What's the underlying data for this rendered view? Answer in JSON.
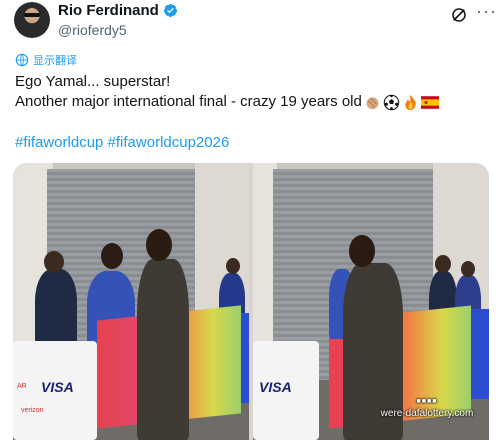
{
  "author": {
    "name": "Rio Ferdinand",
    "handle": "@rioferdy5",
    "verified": true,
    "avatar_icon": "avatar",
    "header_icons": [
      "grok-icon",
      "more-icon"
    ]
  },
  "translate_label": "显示翻译",
  "tweet": {
    "line1": "Ego Yamal... superstar!",
    "line2": "Another major international final - crazy 19 years old",
    "emojis": [
      "clapping-hands-icon",
      "soccer-ball-icon",
      "fire-icon",
      "spain-flag-icon"
    ],
    "hashtags": "#fifaworldcup #fifaworldcup2026"
  },
  "media": {
    "photo_count": 2,
    "banner_left_text": "VISA",
    "banner_right_text": "VISA",
    "banner_small_text": "verizon",
    "banner_small_text2": "AR"
  },
  "watermark": {
    "logo_text": "■■■■",
    "site": "were-dafalottery.com"
  },
  "colors": {
    "accent": "#1d9bf0",
    "text": "#0f1419",
    "secondary": "#536471"
  }
}
